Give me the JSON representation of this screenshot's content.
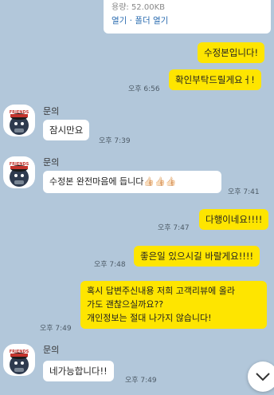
{
  "file_card": {
    "size": "용량: 52.00KB",
    "open_label": "열기",
    "separator": "·",
    "folder_label": "폴더 열기"
  },
  "messages": [
    {
      "id": "m1",
      "side": "me",
      "text": "수정본입니다!",
      "time": ""
    },
    {
      "id": "m2",
      "side": "me",
      "text": "확인부탁드릴게요ㅓ!",
      "time": "오후 6:56"
    },
    {
      "id": "m3",
      "side": "you",
      "sender": "문의",
      "text": "잠시만요",
      "time": "오후 7:39"
    },
    {
      "id": "m4",
      "side": "you",
      "sender": "문의",
      "text": "수정본 완전마음에 듭니다👍🏻👍🏻👍🏻",
      "time": "오후 7:41"
    },
    {
      "id": "m5",
      "side": "me",
      "text": "다행이네요!!!!",
      "time": "오후 7:47"
    },
    {
      "id": "m6",
      "side": "me",
      "text": "좋은일 있으시길 바랄게요!!!!",
      "time": "오후 7:48"
    },
    {
      "id": "m7",
      "side": "me",
      "lines": [
        "혹시 답변주신내용 저희 고객리뷰에 올라",
        "가도 괜찮으실까요??",
        "개인정보는 절대 나가지 않습니다!"
      ],
      "time": "오후 7:49"
    },
    {
      "id": "m8",
      "side": "you",
      "sender": "문의",
      "text": "네가능합니다!!",
      "time": "오후 7:49"
    }
  ],
  "avatar_badge": "FRIENDS",
  "colors": {
    "background": "#b2c7da",
    "my_bubble": "#fee500",
    "their_bubble": "#ffffff"
  },
  "icons": {
    "scroll_down": "chevron-down-icon"
  }
}
